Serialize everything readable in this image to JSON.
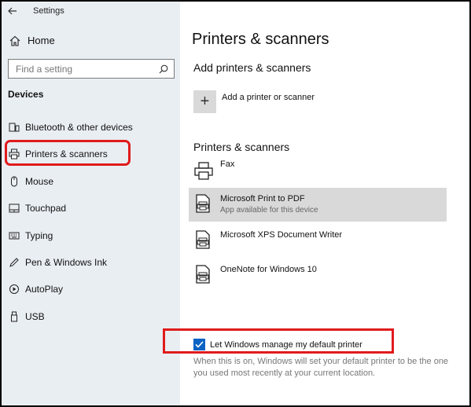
{
  "window": {
    "title": "Settings"
  },
  "sidebar": {
    "home_label": "Home",
    "search_placeholder": "Find a setting",
    "section_label": "Devices",
    "items": [
      {
        "label": "Bluetooth & other devices",
        "icon": "bluetooth-devices-icon"
      },
      {
        "label": "Printers & scanners",
        "icon": "printer-icon",
        "selected": true
      },
      {
        "label": "Mouse",
        "icon": "mouse-icon"
      },
      {
        "label": "Touchpad",
        "icon": "touchpad-icon"
      },
      {
        "label": "Typing",
        "icon": "keyboard-icon"
      },
      {
        "label": "Pen & Windows Ink",
        "icon": "pen-icon"
      },
      {
        "label": "AutoPlay",
        "icon": "autoplay-icon"
      },
      {
        "label": "USB",
        "icon": "usb-icon"
      }
    ]
  },
  "main": {
    "page_title": "Printers & scanners",
    "add_section_title": "Add printers & scanners",
    "add_button_label": "Add a printer or scanner",
    "list_section_title": "Printers & scanners",
    "printers": [
      {
        "name": "Fax",
        "status": "",
        "icon": "fax-icon"
      },
      {
        "name": "Microsoft Print to PDF",
        "status": "App available for this device",
        "icon": "printer-doc-icon",
        "selected": true
      },
      {
        "name": "Microsoft XPS Document Writer",
        "status": "",
        "icon": "printer-doc-icon"
      },
      {
        "name": "OneNote for Windows 10",
        "status": "",
        "icon": "printer-doc-icon"
      }
    ],
    "default_printer_checkbox": {
      "label": "Let Windows manage my default printer",
      "checked": true
    },
    "helper_text": "When this is on, Windows will set your default printer to be the one you used most recently at your current location."
  },
  "colors": {
    "sidebar_bg": "#e9eef3",
    "accent": "#0b63c4",
    "annotation": "#e01b1b",
    "selected_bg": "#d9d9d9"
  }
}
